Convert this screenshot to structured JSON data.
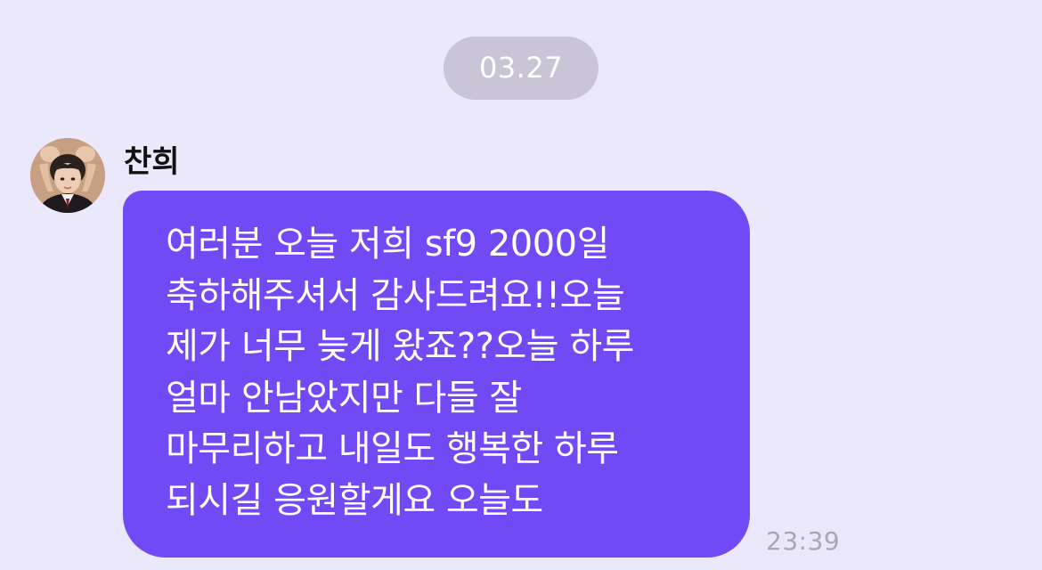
{
  "date_divider": "03.27",
  "message": {
    "sender_name": "찬희",
    "lines": [
      "여러분 오늘 저희 sf9 2000일",
      "축하해주셔서 감사드려요!!오늘",
      "제가 너무 늦게 왔죠??오늘 하루",
      "얼마 안남았지만 다들 잘",
      "마무리하고 내일도 행복한 하루",
      "되시길 응원할게요 오늘도"
    ],
    "time": "23:39"
  },
  "colors": {
    "background": "#ECE8FB",
    "bubble": "#714AF5",
    "date_pill": "#C9C5D6",
    "timestamp": "#A9A6B4"
  }
}
